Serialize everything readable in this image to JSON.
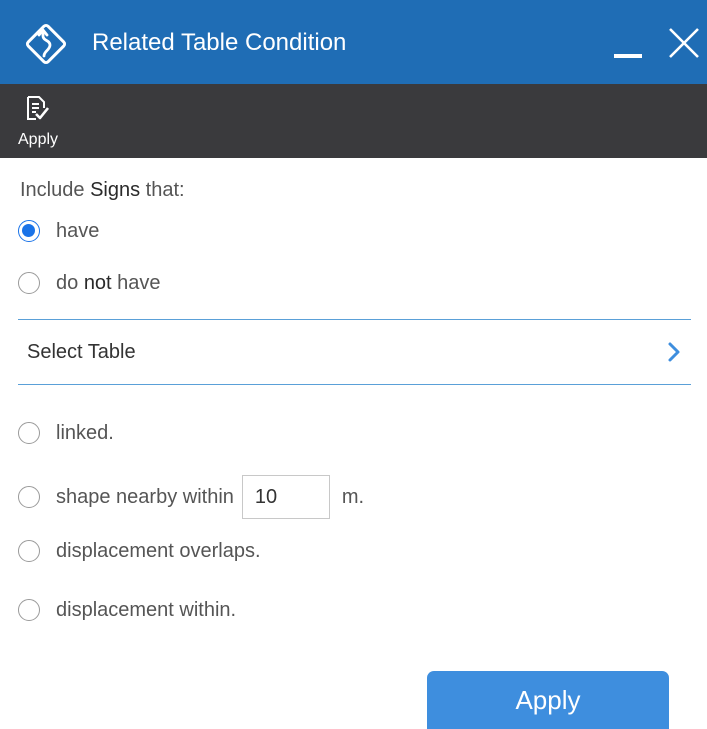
{
  "window": {
    "title": "Related Table Condition",
    "accent_color": "#1f6db5",
    "toolbar_color": "#3a3a3d"
  },
  "toolbar": {
    "apply_label": "Apply",
    "apply_icon": "apply-document-icon"
  },
  "condition": {
    "heading_prefix": "Include ",
    "heading_strong": "Signs",
    "heading_suffix": " that:",
    "presence_options": [
      {
        "prefix": "have",
        "strong": "",
        "suffix": "",
        "checked": true
      },
      {
        "prefix": "do ",
        "strong": "not",
        "suffix": " have",
        "checked": false
      }
    ],
    "select_table_label": "Select Table",
    "relation_options": [
      {
        "label": "linked.",
        "checked": false
      },
      {
        "label": "shape nearby within",
        "checked": false
      },
      {
        "label": "displacement overlaps.",
        "checked": false
      },
      {
        "label": "displacement within.",
        "checked": false
      }
    ],
    "distance_value": "10",
    "distance_unit": "m."
  },
  "footer": {
    "apply_button_label": "Apply",
    "apply_button_color": "#3e8ede"
  }
}
